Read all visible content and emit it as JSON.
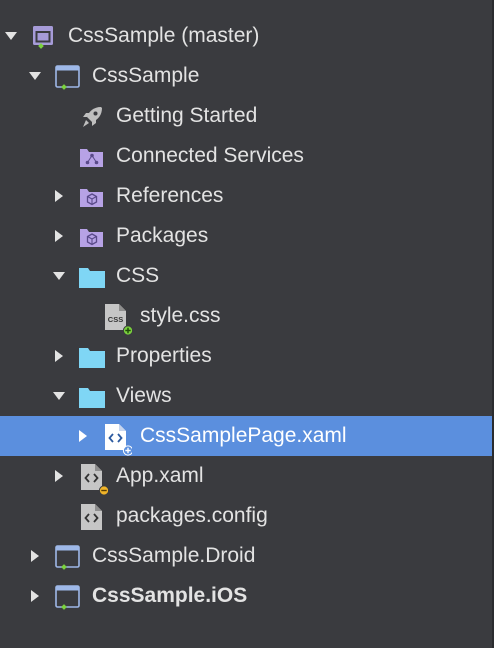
{
  "solution": {
    "root": {
      "label": "CssSample (master)",
      "icon": "solution-icon"
    },
    "projects": [
      {
        "label": "CssSample",
        "icon": "project-icon",
        "expanded": true,
        "children": [
          {
            "label": "Getting Started",
            "icon": "rocket-icon"
          },
          {
            "label": "Connected Services",
            "icon": "connected-services-icon"
          },
          {
            "label": "References",
            "icon": "references-icon",
            "expanded": false
          },
          {
            "label": "Packages",
            "icon": "packages-icon",
            "expanded": false
          },
          {
            "label": "CSS",
            "icon": "folder-icon",
            "expanded": true,
            "children": [
              {
                "label": "style.css",
                "icon": "css-file-icon",
                "file_badge": "CSS",
                "status": "added"
              }
            ]
          },
          {
            "label": "Properties",
            "icon": "folder-icon",
            "expanded": false
          },
          {
            "label": "Views",
            "icon": "folder-icon",
            "expanded": true,
            "children": [
              {
                "label": "CssSamplePage.xaml",
                "icon": "xaml-file-icon",
                "status": "added",
                "selected": true,
                "expanded": false
              }
            ]
          },
          {
            "label": "App.xaml",
            "icon": "xaml-file-icon",
            "status": "modified",
            "expanded": false
          },
          {
            "label": "packages.config",
            "icon": "config-file-icon"
          }
        ]
      },
      {
        "label": "CssSample.Droid",
        "icon": "project-icon",
        "expanded": false
      },
      {
        "label": "CssSample.iOS",
        "icon": "project-icon",
        "expanded": false,
        "bold": true
      }
    ]
  },
  "colors": {
    "background": "#3a3b3f",
    "selection": "#5b8fde",
    "text": "#e3e3e3",
    "folder": "#7fd6f5",
    "badge_purple": "#b7a2e6",
    "added_green": "#7bd23e",
    "modified_yellow": "#f0b429"
  }
}
